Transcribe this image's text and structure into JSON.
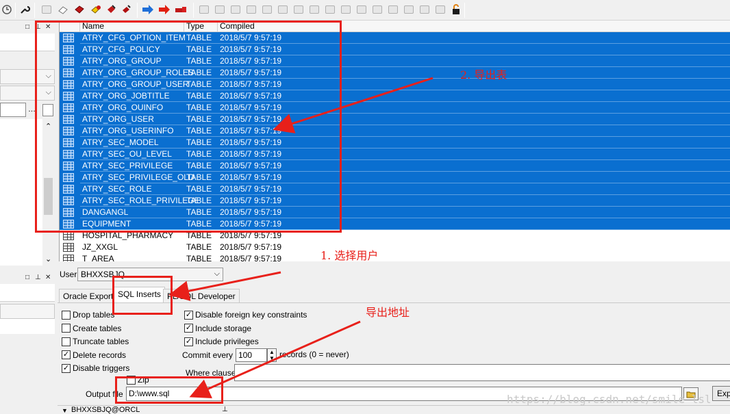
{
  "grid": {
    "columns": [
      "Name",
      "Type",
      "Compiled"
    ],
    "rows": [
      {
        "name": "ATRY_CFG_OPTION_ITEM",
        "type": "TABLE",
        "compiled": "2018/5/7 9:57:19",
        "selected": true
      },
      {
        "name": "ATRY_CFG_POLICY",
        "type": "TABLE",
        "compiled": "2018/5/7 9:57:19",
        "selected": true
      },
      {
        "name": "ATRY_ORG_GROUP",
        "type": "TABLE",
        "compiled": "2018/5/7 9:57:19",
        "selected": true
      },
      {
        "name": "ATRY_ORG_GROUP_ROLES",
        "type": "TABLE",
        "compiled": "2018/5/7 9:57:19",
        "selected": true
      },
      {
        "name": "ATRY_ORG_GROUP_USER",
        "type": "TABLE",
        "compiled": "2018/5/7 9:57:19",
        "selected": true
      },
      {
        "name": "ATRY_ORG_JOBTITLE",
        "type": "TABLE",
        "compiled": "2018/5/7 9:57:19",
        "selected": true
      },
      {
        "name": "ATRY_ORG_OUINFO",
        "type": "TABLE",
        "compiled": "2018/5/7 9:57:19",
        "selected": true
      },
      {
        "name": "ATRY_ORG_USER",
        "type": "TABLE",
        "compiled": "2018/5/7 9:57:19",
        "selected": true
      },
      {
        "name": "ATRY_ORG_USERINFO",
        "type": "TABLE",
        "compiled": "2018/5/7 9:57:19",
        "selected": true
      },
      {
        "name": "ATRY_SEC_MODEL",
        "type": "TABLE",
        "compiled": "2018/5/7 9:57:19",
        "selected": true
      },
      {
        "name": "ATRY_SEC_OU_LEVEL",
        "type": "TABLE",
        "compiled": "2018/5/7 9:57:19",
        "selected": true
      },
      {
        "name": "ATRY_SEC_PRIVILEGE",
        "type": "TABLE",
        "compiled": "2018/5/7 9:57:19",
        "selected": true
      },
      {
        "name": "ATRY_SEC_PRIVILEGE_OLD",
        "type": "TABLE",
        "compiled": "2018/5/7 9:57:19",
        "selected": true
      },
      {
        "name": "ATRY_SEC_ROLE",
        "type": "TABLE",
        "compiled": "2018/5/7 9:57:19",
        "selected": true
      },
      {
        "name": "ATRY_SEC_ROLE_PRIVILEGE",
        "type": "TABLE",
        "compiled": "2018/5/7 9:57:19",
        "selected": true
      },
      {
        "name": "DANGANGL",
        "type": "TABLE",
        "compiled": "2018/5/7 9:57:19",
        "selected": true
      },
      {
        "name": "EQUIPMENT",
        "type": "TABLE",
        "compiled": "2018/5/7 9:57:19",
        "selected": true
      },
      {
        "name": "HOSPITAL_PHARMACY",
        "type": "TABLE",
        "compiled": "2018/5/7 9:57:19",
        "selected": false
      },
      {
        "name": "JZ_XXGL",
        "type": "TABLE",
        "compiled": "2018/5/7 9:57:19",
        "selected": false
      },
      {
        "name": "T_AREA",
        "type": "TABLE",
        "compiled": "2018/5/7 9:57:19",
        "selected": false
      }
    ]
  },
  "user": {
    "label": "User",
    "value": "BHXXSBJQ"
  },
  "tabs": [
    "Oracle Export",
    "SQL Inserts",
    "PL/SQL Developer"
  ],
  "left_options": [
    {
      "label": "Drop tables",
      "checked": false
    },
    {
      "label": "Create tables",
      "checked": false
    },
    {
      "label": "Truncate tables",
      "checked": false
    },
    {
      "label": "Delete records",
      "checked": true
    },
    {
      "label": "Disable triggers",
      "checked": true
    }
  ],
  "right_options": [
    {
      "label": "Disable foreign key constraints",
      "checked": true
    },
    {
      "label": "Include storage",
      "checked": true
    },
    {
      "label": "Include privileges",
      "checked": true
    }
  ],
  "commit": {
    "label": "Commit every",
    "value": "100",
    "suffix": "records (0 = never)"
  },
  "where": {
    "label": "Where clause"
  },
  "zip": {
    "label": "Zip",
    "checked": false
  },
  "output": {
    "label": "Output file",
    "value": "D:\\www.sql"
  },
  "export_button": {
    "label": "Exp"
  },
  "status": {
    "connection": "BHXXSBJQ@ORCL"
  },
  "annotations": {
    "export_tables": "2. 导出表",
    "select_user": "1. 选择用户",
    "export_path": "导出地址"
  },
  "watermark": "https://blog.csdn.net/smile_lsl",
  "colors": {
    "selection": "#0a6fd0",
    "annotation": "#e8201a"
  }
}
